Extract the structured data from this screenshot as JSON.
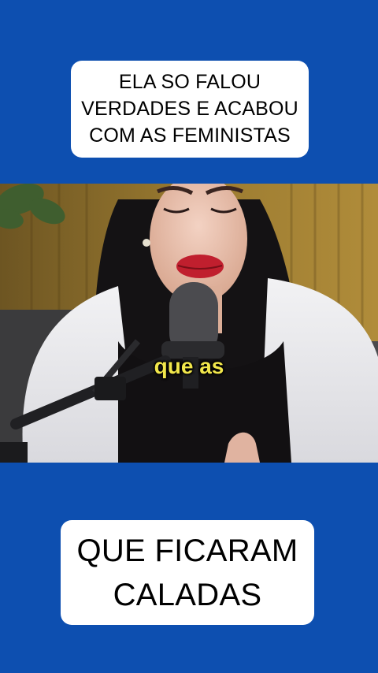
{
  "top_caption": {
    "lines": [
      "ELA SO FALOU",
      "VERDADES E ACABOU",
      "COM AS FEMINISTAS"
    ]
  },
  "video": {
    "subtitle": "que as"
  },
  "bottom_caption": {
    "lines": [
      "QUE FICARAM",
      "CALADAS"
    ]
  },
  "colors": {
    "background": "#0d4fb0",
    "caption_box": "#ffffff",
    "subtitle_text": "#f1e64b"
  }
}
